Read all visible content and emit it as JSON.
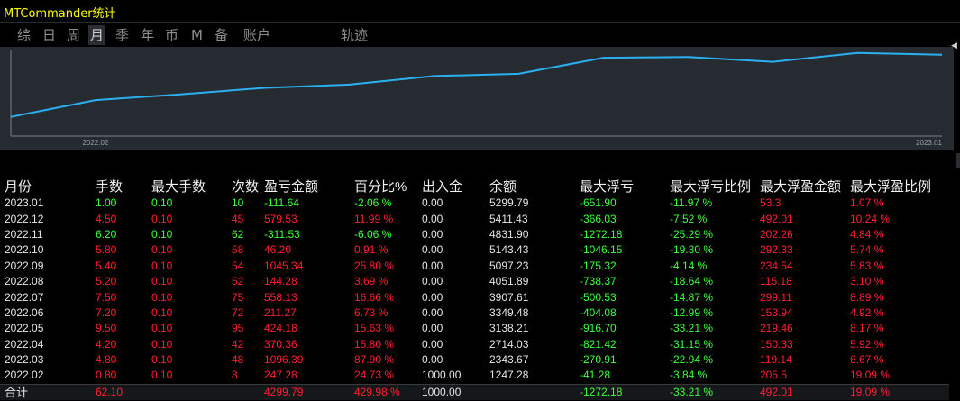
{
  "window": {
    "title": "MTCommander统计"
  },
  "tabs": [
    {
      "label": "综",
      "active": false
    },
    {
      "label": "日",
      "active": false
    },
    {
      "label": "周",
      "active": false
    },
    {
      "label": "月",
      "active": true
    },
    {
      "label": "季",
      "active": false
    },
    {
      "label": "年",
      "active": false
    },
    {
      "label": "币",
      "active": false
    },
    {
      "label": "M",
      "active": false
    },
    {
      "label": "备",
      "active": false
    },
    {
      "label": "账户",
      "active": false
    },
    {
      "label": "轨迹",
      "active": false
    }
  ],
  "chart_data": {
    "type": "line",
    "x": [
      "2022.02",
      "2022.03",
      "2022.04",
      "2022.05",
      "2022.06",
      "2022.07",
      "2022.08",
      "2022.09",
      "2022.10",
      "2022.11",
      "2022.12",
      "2023.01"
    ],
    "series": [
      {
        "values": [
          1247.28,
          2343.67,
          2714.03,
          3138.21,
          3349.48,
          3907.61,
          4051.89,
          5097.23,
          5143.43,
          4831.9,
          5411.43,
          5299.79
        ]
      }
    ],
    "x_tick_labels": [
      "2022.02",
      "2023.01"
    ],
    "line_color": "#2ab0f0",
    "background": "#262b31"
  },
  "table": {
    "headers": [
      "月份",
      "手数",
      "最大手数",
      "次数",
      "盈亏金额",
      "百分比%",
      "出入金",
      "余额",
      "最大浮亏",
      "最大浮亏比例",
      "最大浮盈金额",
      "最大浮盈比例"
    ],
    "rows": [
      {
        "month": "2023.01",
        "lots": "1.00",
        "max_lots": "0.10",
        "count": "10",
        "pnl": "-111.64",
        "pct": "-2.06 %",
        "io": "0.00",
        "balance": "5299.79",
        "max_dd": "-651.90",
        "max_dd_pct": "-11.97 %",
        "max_profit": "53.3",
        "max_profit_pct": "1.07 %",
        "sign": "neg"
      },
      {
        "month": "2022.12",
        "lots": "4.50",
        "max_lots": "0.10",
        "count": "45",
        "pnl": "579.53",
        "pct": "11.99 %",
        "io": "0.00",
        "balance": "5411.43",
        "max_dd": "-366.03",
        "max_dd_pct": "-7.52 %",
        "max_profit": "492.01",
        "max_profit_pct": "10.24 %",
        "sign": "pos"
      },
      {
        "month": "2022.11",
        "lots": "6.20",
        "max_lots": "0.10",
        "count": "62",
        "pnl": "-311.53",
        "pct": "-6.06 %",
        "io": "0.00",
        "balance": "4831.90",
        "max_dd": "-1272.18",
        "max_dd_pct": "-25.29 %",
        "max_profit": "202.26",
        "max_profit_pct": "4.84 %",
        "sign": "neg"
      },
      {
        "month": "2022.10",
        "lots": "5.80",
        "max_lots": "0.10",
        "count": "58",
        "pnl": "46.20",
        "pct": "0.91 %",
        "io": "0.00",
        "balance": "5143.43",
        "max_dd": "-1046.15",
        "max_dd_pct": "-19.30 %",
        "max_profit": "292.33",
        "max_profit_pct": "5.74 %",
        "sign": "pos"
      },
      {
        "month": "2022.09",
        "lots": "5.40",
        "max_lots": "0.10",
        "count": "54",
        "pnl": "1045.34",
        "pct": "25.80 %",
        "io": "0.00",
        "balance": "5097.23",
        "max_dd": "-175.32",
        "max_dd_pct": "-4.14 %",
        "max_profit": "234.54",
        "max_profit_pct": "5.83 %",
        "sign": "pos"
      },
      {
        "month": "2022.08",
        "lots": "5.20",
        "max_lots": "0.10",
        "count": "52",
        "pnl": "144.28",
        "pct": "3.69 %",
        "io": "0.00",
        "balance": "4051.89",
        "max_dd": "-738.37",
        "max_dd_pct": "-18.64 %",
        "max_profit": "115.18",
        "max_profit_pct": "3.10 %",
        "sign": "pos"
      },
      {
        "month": "2022.07",
        "lots": "7.50",
        "max_lots": "0.10",
        "count": "75",
        "pnl": "558.13",
        "pct": "16.66 %",
        "io": "0.00",
        "balance": "3907.61",
        "max_dd": "-500.53",
        "max_dd_pct": "-14.87 %",
        "max_profit": "299.11",
        "max_profit_pct": "8.89 %",
        "sign": "pos"
      },
      {
        "month": "2022.06",
        "lots": "7.20",
        "max_lots": "0.10",
        "count": "72",
        "pnl": "211.27",
        "pct": "6.73 %",
        "io": "0.00",
        "balance": "3349.48",
        "max_dd": "-404.08",
        "max_dd_pct": "-12.99 %",
        "max_profit": "153.94",
        "max_profit_pct": "4.92 %",
        "sign": "pos"
      },
      {
        "month": "2022.05",
        "lots": "9.50",
        "max_lots": "0.10",
        "count": "95",
        "pnl": "424.18",
        "pct": "15.63 %",
        "io": "0.00",
        "balance": "3138.21",
        "max_dd": "-916.70",
        "max_dd_pct": "-33.21 %",
        "max_profit": "219.46",
        "max_profit_pct": "8.17 %",
        "sign": "pos"
      },
      {
        "month": "2022.04",
        "lots": "4.20",
        "max_lots": "0.10",
        "count": "42",
        "pnl": "370.36",
        "pct": "15.80 %",
        "io": "0.00",
        "balance": "2714.03",
        "max_dd": "-821.42",
        "max_dd_pct": "-31.15 %",
        "max_profit": "150.33",
        "max_profit_pct": "5.92 %",
        "sign": "pos"
      },
      {
        "month": "2022.03",
        "lots": "4.80",
        "max_lots": "0.10",
        "count": "48",
        "pnl": "1096.39",
        "pct": "87.90 %",
        "io": "0.00",
        "balance": "2343.67",
        "max_dd": "-270.91",
        "max_dd_pct": "-22.94 %",
        "max_profit": "119.14",
        "max_profit_pct": "6.67 %",
        "sign": "pos"
      },
      {
        "month": "2022.02",
        "lots": "0.80",
        "max_lots": "0.10",
        "count": "8",
        "pnl": "247.28",
        "pct": "24.73 %",
        "io": "1000.00",
        "balance": "1247.28",
        "max_dd": "-41.28",
        "max_dd_pct": "-3.84 %",
        "max_profit": "205.5",
        "max_profit_pct": "19.09 %",
        "sign": "pos"
      }
    ],
    "total": {
      "label": "合计",
      "lots": "62.10",
      "max_lots": "",
      "count": "",
      "pnl": "4299.79",
      "pct": "429.98 %",
      "io": "1000.00",
      "balance": "",
      "max_dd": "-1272.18",
      "max_dd_pct": "-33.21 %",
      "max_profit": "492.01",
      "max_profit_pct": "19.09 %"
    }
  },
  "colors": {
    "positive": "#ff1f2d",
    "negative": "#3cff3c",
    "title": "#ffff00"
  }
}
